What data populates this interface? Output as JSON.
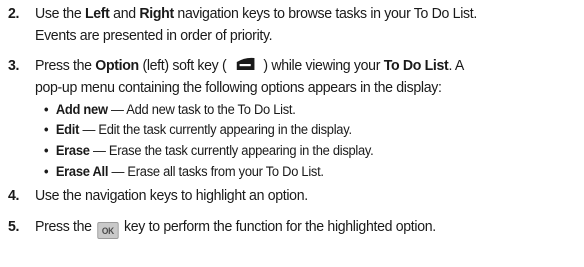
{
  "steps": [
    {
      "num": "2.",
      "line1": {
        "a": "Use the ",
        "b1": "Left",
        "c": " and ",
        "b2": "Right",
        "d": " navigation keys to browse tasks in your To Do List."
      },
      "line2": "Events are presented in order of priority."
    },
    {
      "num": "3.",
      "line1": {
        "a": "Press the ",
        "b1": "Option",
        "c": " (left) soft key (",
        "d": ") while viewing your ",
        "b2": "To Do List",
        "e": ". A"
      },
      "line2": "pop-up menu containing the following options appears in the display:",
      "icon": "left-softkey-icon"
    },
    {
      "num": "4.",
      "line1": "Use the navigation keys to highlight an option."
    },
    {
      "num": "5.",
      "line1": {
        "a": "Press the ",
        "key": "OK",
        "b": " key to perform the function for the highlighted option."
      },
      "icon": "ok-key-icon"
    }
  ],
  "options": [
    {
      "term": "Add new",
      "sep": " — ",
      "desc": "Add new task to the To Do List."
    },
    {
      "term": "Edit",
      "sep": " — ",
      "desc": "Edit the task currently appearing in the display."
    },
    {
      "term": "Erase",
      "sep": " — ",
      "desc": "Erase the task currently appearing in the display."
    },
    {
      "term": "Erase All",
      "sep": " — ",
      "desc": "Erase all tasks from your To Do List."
    }
  ],
  "bullet": "•"
}
